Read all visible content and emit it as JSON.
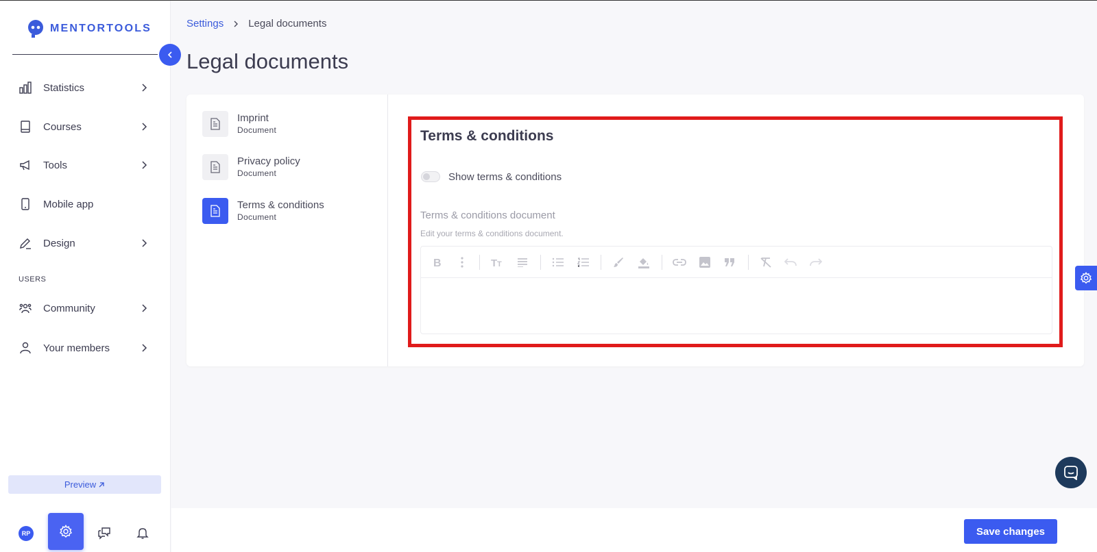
{
  "brand": {
    "name": "MENTORTOOLS",
    "accent": "#3b5bf0",
    "highlight": "#e01b1b"
  },
  "sidebar": {
    "items": [
      {
        "label": "Statistics",
        "icon": "bar-chart-icon",
        "has_children": true
      },
      {
        "label": "Courses",
        "icon": "book-icon",
        "has_children": true
      },
      {
        "label": "Tools",
        "icon": "megaphone-icon",
        "has_children": true
      },
      {
        "label": "Mobile app",
        "icon": "phone-icon",
        "has_children": false
      },
      {
        "label": "Design",
        "icon": "pencil-icon",
        "has_children": true
      }
    ],
    "users_section": "USERS",
    "user_items": [
      {
        "label": "Community",
        "icon": "community-icon",
        "has_children": true
      },
      {
        "label": "Your members",
        "icon": "user-icon",
        "has_children": true
      }
    ],
    "preview_label": "Preview",
    "avatar_initials": "RP"
  },
  "breadcrumb": {
    "parent": "Settings",
    "current": "Legal documents"
  },
  "page_title": "Legal documents",
  "documents": [
    {
      "title": "Imprint",
      "subtitle": "Document",
      "active": false
    },
    {
      "title": "Privacy policy",
      "subtitle": "Document",
      "active": false
    },
    {
      "title": "Terms & conditions",
      "subtitle": "Document",
      "active": true
    }
  ],
  "terms": {
    "title": "Terms & conditions",
    "toggle_label": "Show terms & conditions",
    "toggle_on": false,
    "field_label": "Terms & conditions document",
    "field_help": "Edit your terms & conditions document.",
    "editor_content": ""
  },
  "footer": {
    "save_label": "Save changes"
  }
}
